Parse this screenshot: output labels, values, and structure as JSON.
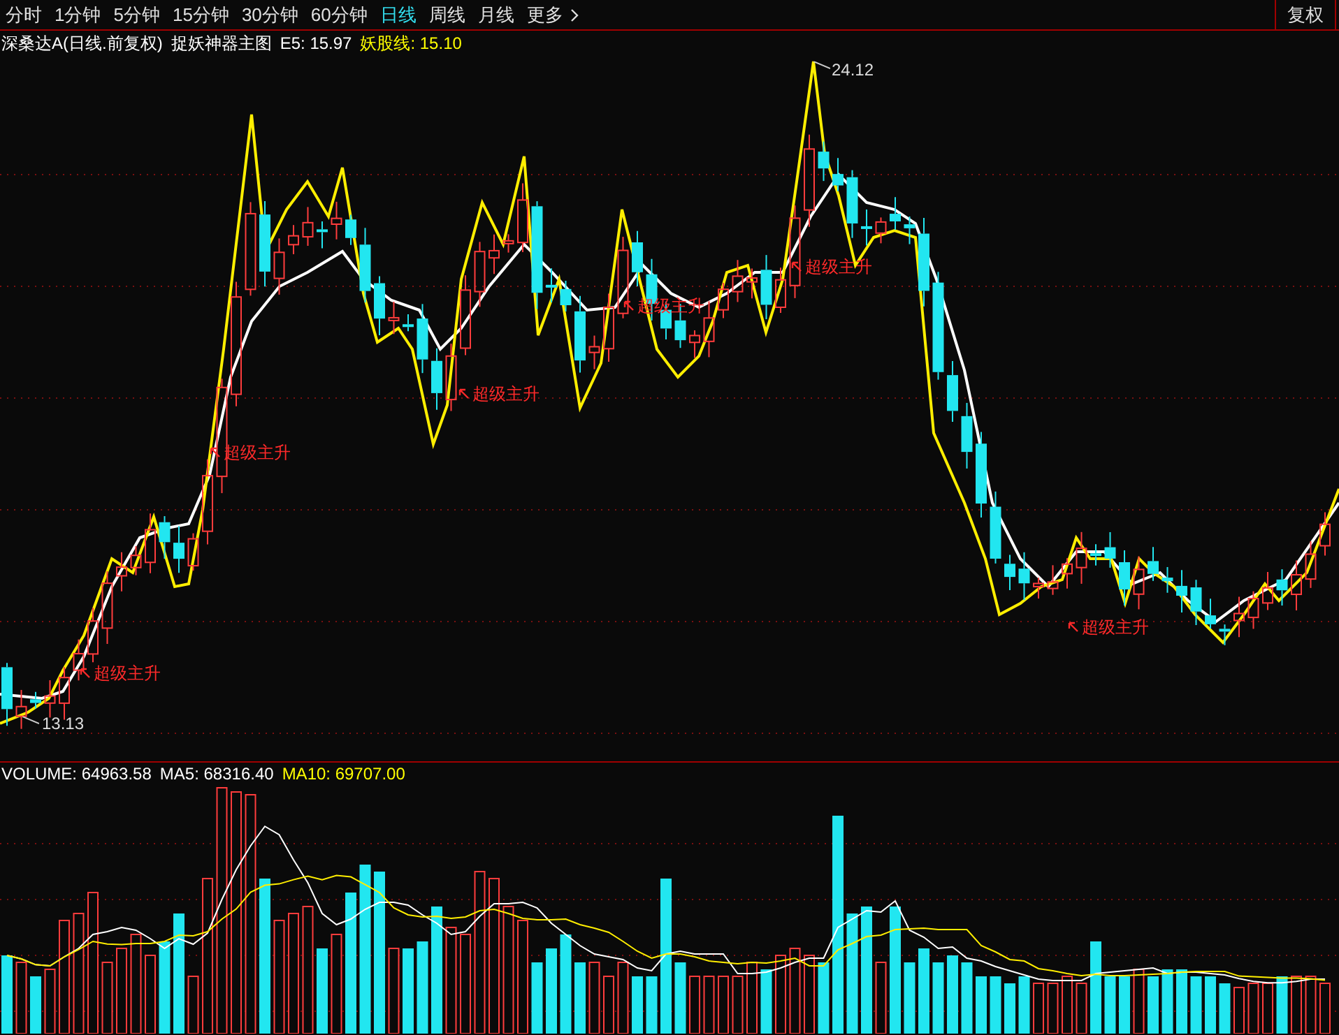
{
  "tabs": [
    {
      "label": "分时",
      "selected": false
    },
    {
      "label": "1分钟",
      "selected": false
    },
    {
      "label": "5分钟",
      "selected": false
    },
    {
      "label": "15分钟",
      "selected": false
    },
    {
      "label": "30分钟",
      "selected": false
    },
    {
      "label": "60分钟",
      "selected": false
    },
    {
      "label": "日线",
      "selected": true
    },
    {
      "label": "周线",
      "selected": false
    },
    {
      "label": "月线",
      "selected": false
    }
  ],
  "more": {
    "label": "更多"
  },
  "adjust_button": "复权",
  "chart_header": [
    {
      "text": "深桑达A(日线.前复权)",
      "color": "#ffffff"
    },
    {
      "text": "捉妖神器主图",
      "color": "#ffffff"
    },
    {
      "text": "E5: 15.97",
      "color": "#ffffff"
    },
    {
      "text": "妖股线: 15.10",
      "color": "#ffff00"
    }
  ],
  "price_markers": {
    "high": "24.12",
    "low": "13.13"
  },
  "signals": [
    "超级主升",
    "超级主升",
    "超级主升",
    "超级主升",
    "超级主升",
    "超级主升"
  ],
  "volume_header": [
    {
      "text": "VOLUME: 64963.58",
      "color": "#ffffff"
    },
    {
      "text": "MA5: 68316.40",
      "color": "#ffffff"
    },
    {
      "text": "MA10: 69707.00",
      "color": "#ffff00"
    }
  ]
}
